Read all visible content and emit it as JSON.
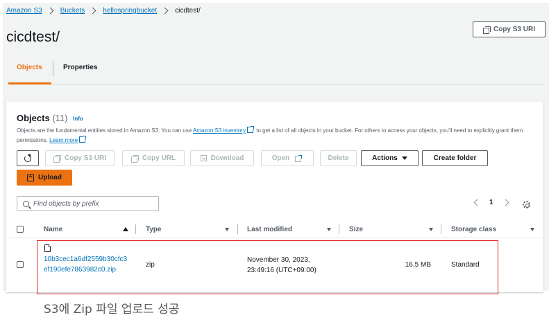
{
  "breadcrumb": [
    "Amazon S3",
    "Buckets",
    "hellospringbucket",
    "cicdtest/"
  ],
  "page_title": "cicdtest/",
  "header_copy_uri": "Copy S3 URI",
  "tabs": [
    {
      "label": "Objects",
      "active": true
    },
    {
      "label": "Properties",
      "active": false
    }
  ],
  "objects": {
    "title": "Objects",
    "count": "(11)",
    "info": "Info",
    "desc_prefix": "Objects are the fundamental entities stored in Amazon S3. You can use ",
    "desc_link": "Amazon S3 inventory",
    "desc_suffix": " to get a list of all objects in your bucket. For others to access your objects, you'll need to explicitly grant them permissions. ",
    "learn_more": "Learn more",
    "buttons": {
      "copy_uri": "Copy S3 URI",
      "copy_url": "Copy URL",
      "download": "Download",
      "open": "Open",
      "delete": "Delete",
      "actions": "Actions",
      "create_folder": "Create folder",
      "upload": "Upload"
    },
    "search_placeholder": "Find objects by prefix",
    "page": "1"
  },
  "columns": [
    "Name",
    "Type",
    "Last modified",
    "Size",
    "Storage class"
  ],
  "rows": [
    {
      "name": "10b3cec1a6df2559b30cfc3ef190efe7863982c0.zip",
      "type": "zip",
      "modified_date": "November 30, 2023,",
      "modified_time": "23:49:16 (UTC+09:00)",
      "size": "16.5 MB",
      "storage_class": "Standard"
    }
  ],
  "caption": "S3에 Zip 파일 업로드 성공",
  "colors": {
    "accent": "#ec7211",
    "link": "#0073bb",
    "highlight": "#e02020"
  }
}
